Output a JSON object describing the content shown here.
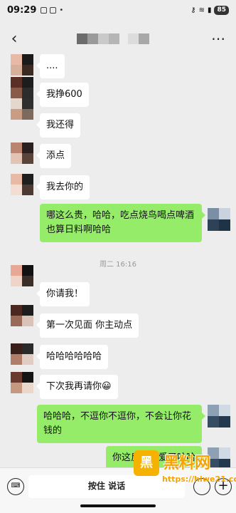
{
  "status_bar": {
    "time": "09:29",
    "battery": "85",
    "icons": [
      "gallery-icon",
      "scan-icon",
      "dot-icon",
      "key-icon",
      "wifi-icon",
      "signal-icon"
    ]
  },
  "header": {
    "title_mosaic_colors": [
      "#6c6c6c",
      "#9a9a9a",
      "#c9c9c9",
      "#b5b5b5",
      "#dcdcdc",
      "#a8a8a8"
    ]
  },
  "messages": [
    {
      "side": "left",
      "text": "....",
      "avatar": [
        "#e9b9a8",
        "#1a1a1a",
        "#d7b09b",
        "#3a2a22"
      ]
    },
    {
      "side": "left",
      "text": "我挣600",
      "avatar": [
        "#5c2f26",
        "#1c1c1c",
        "#8a5a48",
        "#2c2c2c"
      ]
    },
    {
      "side": "left",
      "text": "我还得",
      "avatar": [
        "#e5d7cd",
        "#2e2e2e",
        "#c89d83",
        "#7d6a5e"
      ]
    },
    {
      "side": "left",
      "text": "添点",
      "avatar": [
        "#b98470",
        "#2a2020",
        "#e2c3b4",
        "#5a4338"
      ]
    },
    {
      "side": "left",
      "text": "我去你的",
      "avatar": [
        "#e8b9a5",
        "#1e1e1e",
        "#f1ddd2",
        "#4a3a32"
      ]
    },
    {
      "side": "right",
      "text": "哪这么贵，哈哈，吃点烧鸟喝点啤酒也算日料啊哈哈",
      "avatar": [
        "#7a8fa6",
        "#c8d3df",
        "#2e4257",
        "#1f3347"
      ]
    },
    {
      "side": "left",
      "text": "你请我！",
      "avatar": [
        "#e7a995",
        "#121212",
        "#f0d4c8",
        "#3b2e28"
      ]
    },
    {
      "side": "left",
      "text": "第一次见面 你主动点",
      "avatar": [
        "#4a2720",
        "#1d1d1d",
        "#9a6a58",
        "#d9c3b8"
      ]
    },
    {
      "side": "left",
      "text": "哈哈哈哈哈哈",
      "avatar": [
        "#3a1e1a",
        "#2a2a2a",
        "#b07d69",
        "#e0ccc2"
      ]
    },
    {
      "side": "left",
      "text": "下次我再请你😀",
      "avatar": [
        "#6a3a30",
        "#151515",
        "#c5987f",
        "#e9d7cc"
      ]
    },
    {
      "side": "right",
      "text": "哈哈哈，不逗你不逗你，不会让你花钱的",
      "avatar": [
        "#8ea0b3",
        "#d0dae4",
        "#354c62",
        "#24394e"
      ]
    },
    {
      "side": "right",
      "text": "你这反应我爱了哈哈",
      "avatar": [
        "#8ea0b3",
        "#d0dae4",
        "#354c62",
        "#24394e"
      ]
    }
  ],
  "timestamp": "周二 16:16",
  "input_bar": {
    "hold_to_talk": "按住 说话"
  },
  "watermark": {
    "logo_char": "黑",
    "name": "黑料网",
    "url": "https://hiwe21.com"
  }
}
